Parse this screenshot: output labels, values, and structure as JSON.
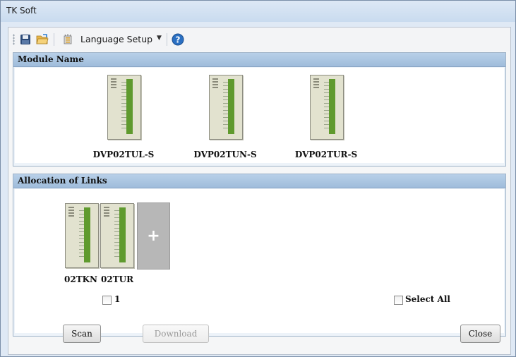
{
  "window": {
    "title": "TK Soft"
  },
  "toolbar": {
    "save_icon": "save-icon",
    "open_icon": "open-folder-icon",
    "language_icon": "language-setup-icon",
    "language_label": "Language Setup",
    "help_icon": "help-icon"
  },
  "module_panel": {
    "title": "Module Name",
    "modules": [
      {
        "label": "DVP02TUL-S"
      },
      {
        "label": "DVP02TUN-S"
      },
      {
        "label": "DVP02TUR-S"
      }
    ]
  },
  "links_panel": {
    "title": "Allocation of Links",
    "links": [
      {
        "label": "02TKN"
      },
      {
        "label": "02TUR"
      }
    ],
    "add_symbol": "+",
    "group_checkbox_label": "1",
    "select_all_label": "Select All"
  },
  "buttons": {
    "scan": "Scan",
    "download": "Download",
    "close": "Close"
  },
  "colors": {
    "accent": "#2a7dd2",
    "header": "#a9c4e0",
    "module_strip": "#5f9a2e",
    "add_slot": "#b7b7b7"
  }
}
